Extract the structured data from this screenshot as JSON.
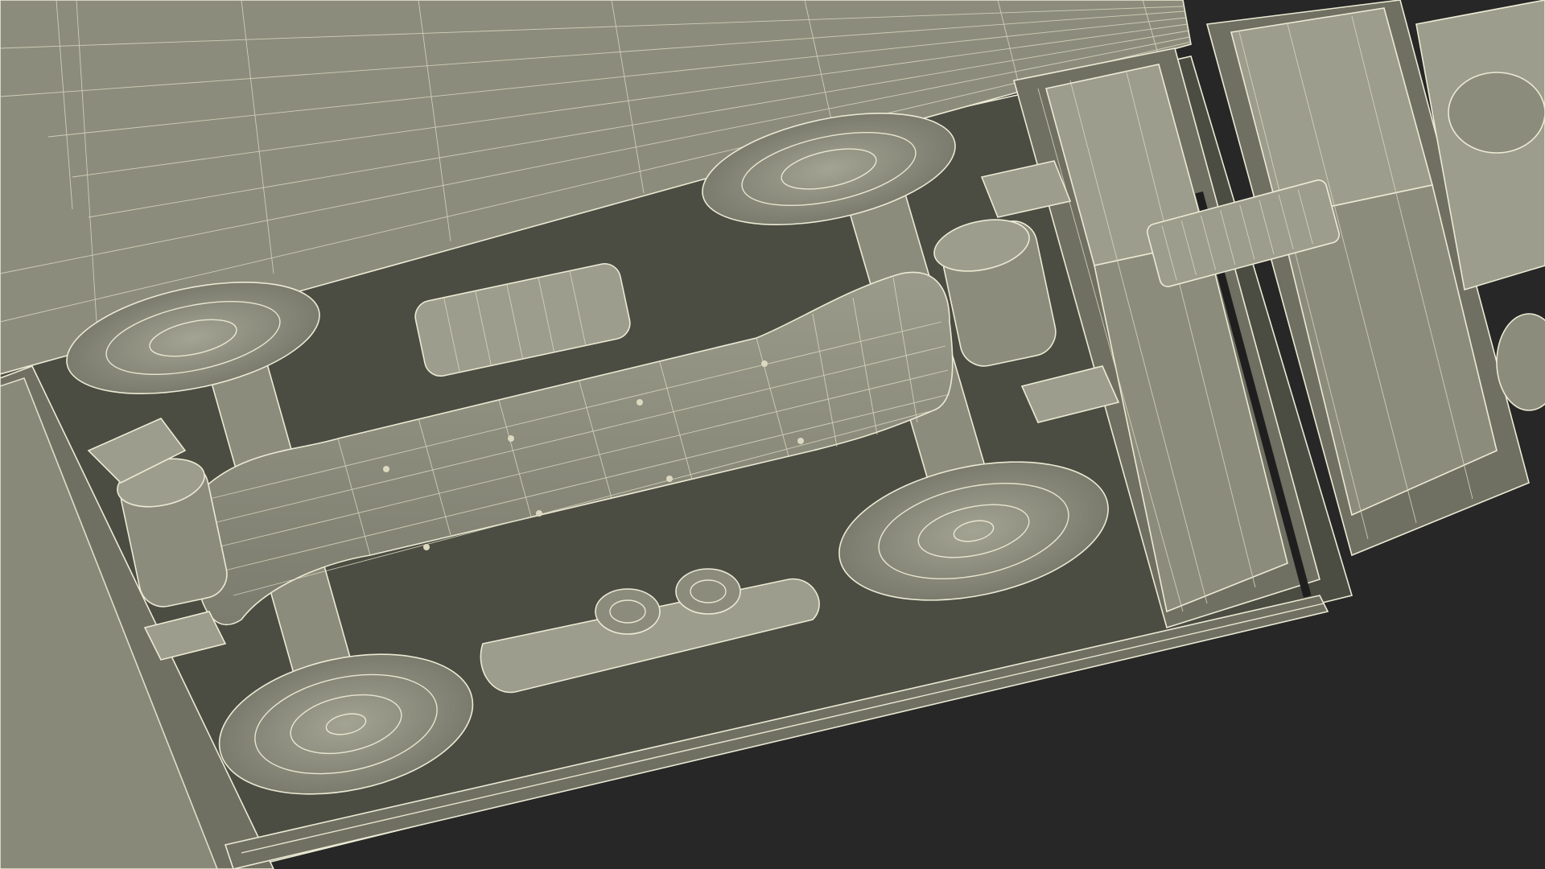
{
  "scene": {
    "subject": "",
    "render_style": "wireframe-over-shaded",
    "colors": {
      "background": "#272727",
      "surface": "#878878",
      "surface_dark": "#4b4c42",
      "wire": "#e9e6cf"
    }
  }
}
